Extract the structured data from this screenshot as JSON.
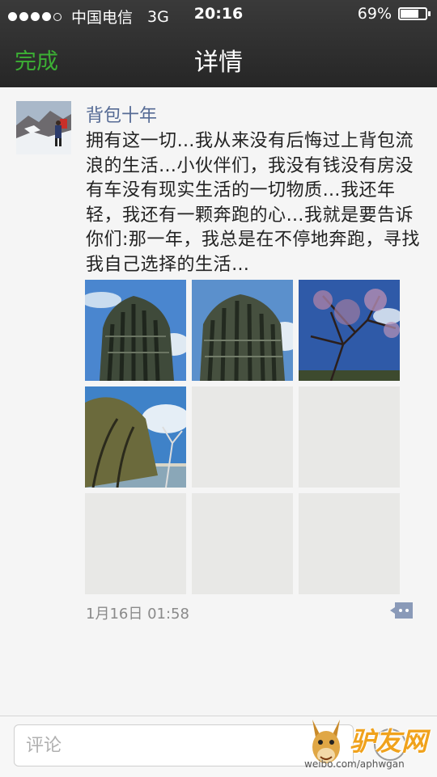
{
  "status_bar": {
    "carrier": "中国电信",
    "network": "3G",
    "time": "20:16",
    "battery": "69%",
    "battery_level": 0.69
  },
  "nav": {
    "done_label": "完成",
    "title": "详情"
  },
  "post": {
    "username": "背包十年",
    "text": "拥有这一切…我从来没有后悔过上背包流浪的生活…小伙伴们，我没有钱没有房没有车没有现实生活的一切物质…我还年轻，我还有一颗奔跑的心…我就是要告诉你们:那一年，我总是在不停地奔跑，寻找我自己选择的生活…",
    "timestamp": "1月16日 01:58"
  },
  "comment_bar": {
    "placeholder": "评论"
  },
  "icons": {
    "comment": "comment-bubble-icon",
    "emoji": "emoji-icon"
  },
  "watermark": {
    "logo_text": "驴友网",
    "caption": "weibo.com/aphwgan"
  },
  "colors": {
    "accent_green": "#3cb034",
    "username_blue": "#566b95",
    "header_dark": "#2d2d2d"
  }
}
